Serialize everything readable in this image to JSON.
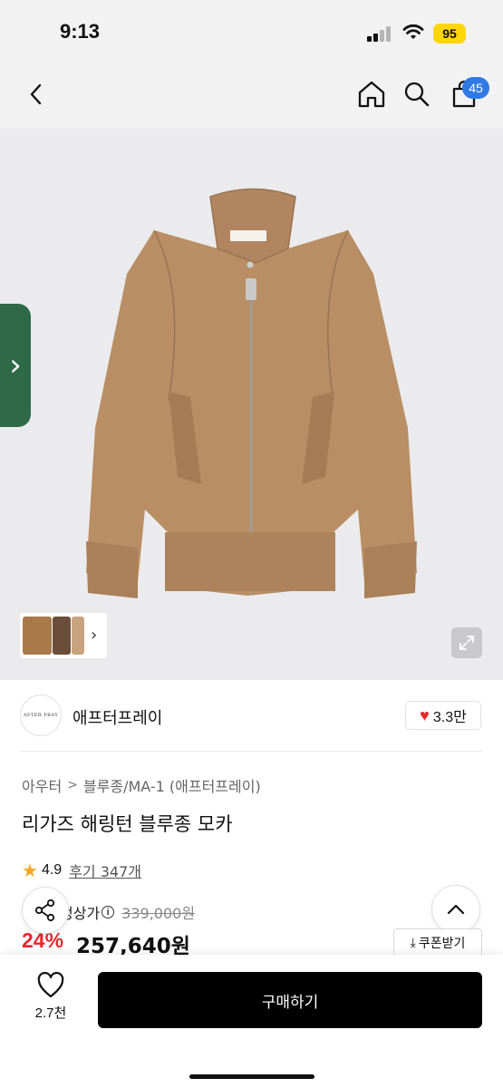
{
  "status_bar": {
    "time": "9:13",
    "battery": "95",
    "icons": [
      "signal-icon",
      "wifi-icon",
      "battery-icon"
    ]
  },
  "nav": {
    "icons": [
      "back-icon",
      "home-icon",
      "search-icon",
      "cart-icon"
    ],
    "cart_count": "45"
  },
  "product_image": {
    "icons": [
      "chevron-right-icon",
      "expand-icon"
    ],
    "thumbnail_colors": [
      "#a9794a",
      "#6b4e3a",
      "#c7a47f"
    ]
  },
  "brand": {
    "logo_text": "AFTER PRAY",
    "name": "애프터프레이",
    "likes": "3.3만"
  },
  "product": {
    "breadcrumb": [
      "아우터",
      "블루종/MA-1 (애프터프레이)"
    ],
    "title": "리가즈 해링턴 블루종 모카",
    "rating": "4.9",
    "reviews": "후기 347개",
    "price_label": "정상가",
    "original_price": "339,000원",
    "discount": "24%",
    "sale_price": "257,640원",
    "coupon_label": "쿠폰받기"
  },
  "bottom_bar": {
    "wish_count": "2.7천",
    "buy_label": "구매하기"
  },
  "colors": {
    "accent_blue": "#2f7ae5",
    "discount_red": "#e7282d",
    "side_tab_green": "#2e6a47",
    "jacket_camel": "#b98e64",
    "battery_yellow": "#ffd60a"
  }
}
